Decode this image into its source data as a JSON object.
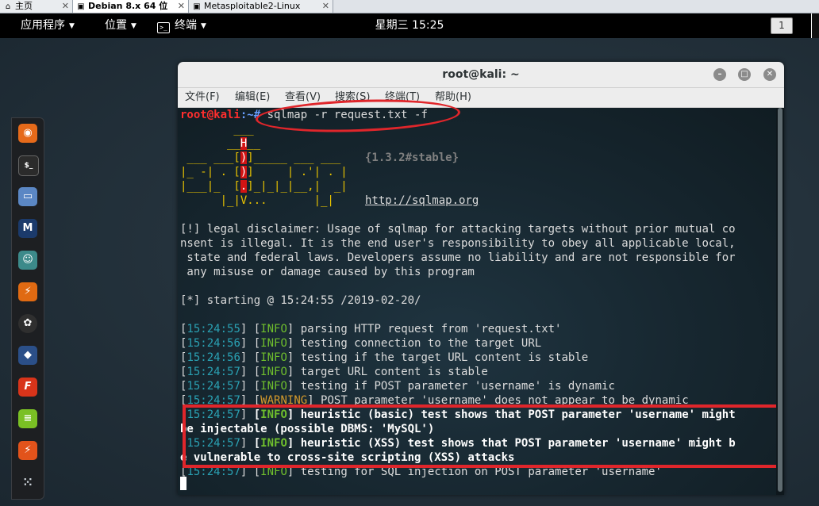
{
  "tabs": [
    {
      "label": "主页",
      "icon": "home-icon"
    },
    {
      "label": "Debian 8.x 64 位",
      "icon": "vm-icon"
    },
    {
      "label": "Metasploitable2-Linux",
      "icon": "vm-icon"
    }
  ],
  "topbar": {
    "applications": "应用程序",
    "places": "位置",
    "terminal": "终端",
    "clock": "星期三 15:25",
    "workspace": "1"
  },
  "dock": {
    "items": [
      "firefox-icon",
      "terminal-icon",
      "files-icon",
      "metasploit-icon",
      "armitage-icon",
      "burpsuite-icon",
      "maltego-icon",
      "beef-icon",
      "faraday-icon",
      "leafpad-icon",
      "cutycapt-icon",
      "show-apps-icon"
    ]
  },
  "window": {
    "title": "root@kali: ~",
    "menu": [
      "文件(F)",
      "编辑(E)",
      "查看(V)",
      "搜索(S)",
      "终端(T)",
      "帮助(H)"
    ]
  },
  "terminal": {
    "prompt_user": "root@kali",
    "prompt_path": ":~# ",
    "command": "sqlmap -r request.txt -f",
    "version": "{1.3.2#stable}",
    "url": "http://sqlmap.org",
    "disclaimer": [
      "[!] legal disclaimer: Usage of sqlmap for attacking targets without prior mutual co",
      "nsent is illegal. It is the end user's responsibility to obey all applicable local,",
      " state and federal laws. Developers assume no liability and are not responsible for",
      " any misuse or damage caused by this program"
    ],
    "starting": "[*] starting @ 15:24:55 /2019-02-20/",
    "log": [
      {
        "time": "15:24:55",
        "level": "INFO",
        "text": " parsing HTTP request from 'request.txt'"
      },
      {
        "time": "15:24:56",
        "level": "INFO",
        "text": " testing connection to the target URL"
      },
      {
        "time": "15:24:56",
        "level": "INFO",
        "text": " testing if the target URL content is stable"
      },
      {
        "time": "15:24:57",
        "level": "INFO",
        "text": " target URL content is stable"
      },
      {
        "time": "15:24:57",
        "level": "INFO",
        "text": " testing if POST parameter 'username' is dynamic"
      },
      {
        "time": "15:24:57",
        "level": "WARNING",
        "text": " POST parameter 'username' does not appear to be dynamic"
      },
      {
        "time": "15:24:57",
        "level": "INFO",
        "text": " heuristic (basic) test shows that POST parameter 'username' might",
        "cont": "be injectable (possible DBMS: 'MySQL')"
      },
      {
        "time": "15:24:57",
        "level": "INFO",
        "text": " heuristic (XSS) test shows that POST parameter 'username' might b",
        "cont": "e vulnerable to cross-site scripting (XSS) attacks"
      },
      {
        "time": "15:24:57",
        "level": "INFO",
        "text": " testing for SQL injection on POST parameter 'username'"
      }
    ]
  }
}
